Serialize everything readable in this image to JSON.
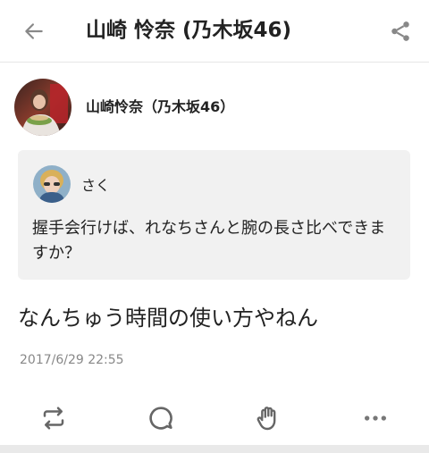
{
  "header": {
    "title": "山崎 怜奈 (乃木坂46)",
    "back_icon": "arrow-left-icon",
    "share_icon": "share-icon"
  },
  "post": {
    "author": "山崎怜奈（乃木坂46）",
    "quote": {
      "name": "さく",
      "text": "握手会行けば、れなちさんと腕の長さ比べできますか？"
    },
    "body": "なんちゅう時間の使い方やねん",
    "timestamp": "2017/6/29 22:55"
  },
  "actions": {
    "icons": [
      "repost-icon",
      "comment-icon",
      "clap-icon",
      "more-icon"
    ]
  },
  "colors": {
    "text": "#222222",
    "muted": "#888888",
    "icon": "#666666",
    "quote_bg": "#f1f1f1"
  }
}
